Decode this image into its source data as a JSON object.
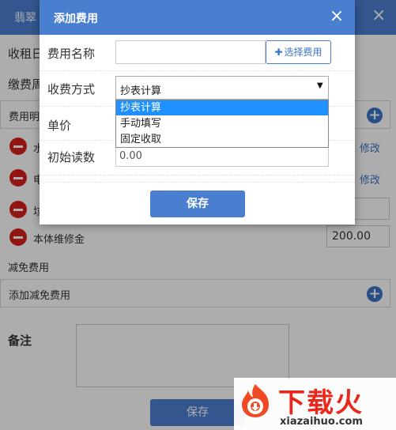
{
  "background": {
    "header_title": "翡翠",
    "close_glyph": "×",
    "row_labels": [
      "收租日",
      "缴费周"
    ],
    "fee_detail_label": "费用明",
    "fees": [
      {
        "name": "水",
        "action": "修改"
      },
      {
        "name": "电",
        "action": "修改"
      },
      {
        "name": "垃",
        "action": ""
      },
      {
        "name": "本体维修金",
        "action": ""
      }
    ],
    "fee_amount": "200.00",
    "reduce_label": "减免费用",
    "add_reduce_label": "添加减免费用",
    "remark_label": "备注",
    "save_label": "保存"
  },
  "modal": {
    "title": "添加费用",
    "close_glyph": "×",
    "fee_name_label": "费用名称",
    "fee_name_value": "",
    "choose_fee_label": "选择费用",
    "method_label": "收费方式",
    "method_selected": "抄表计算",
    "method_options": [
      "抄表计算",
      "手动填写",
      "固定收取"
    ],
    "unit_price_label": "单价",
    "initial_reading_label": "初始读数",
    "initial_reading_value": "0.00",
    "save_label": "保存"
  },
  "watermark": {
    "brand": "下载火",
    "url": "xiazaihuo.com"
  },
  "colors": {
    "primary": "#4a7fd0",
    "danger": "#d9201c",
    "highlight": "#1e90ff",
    "brand": "#e8281c"
  }
}
